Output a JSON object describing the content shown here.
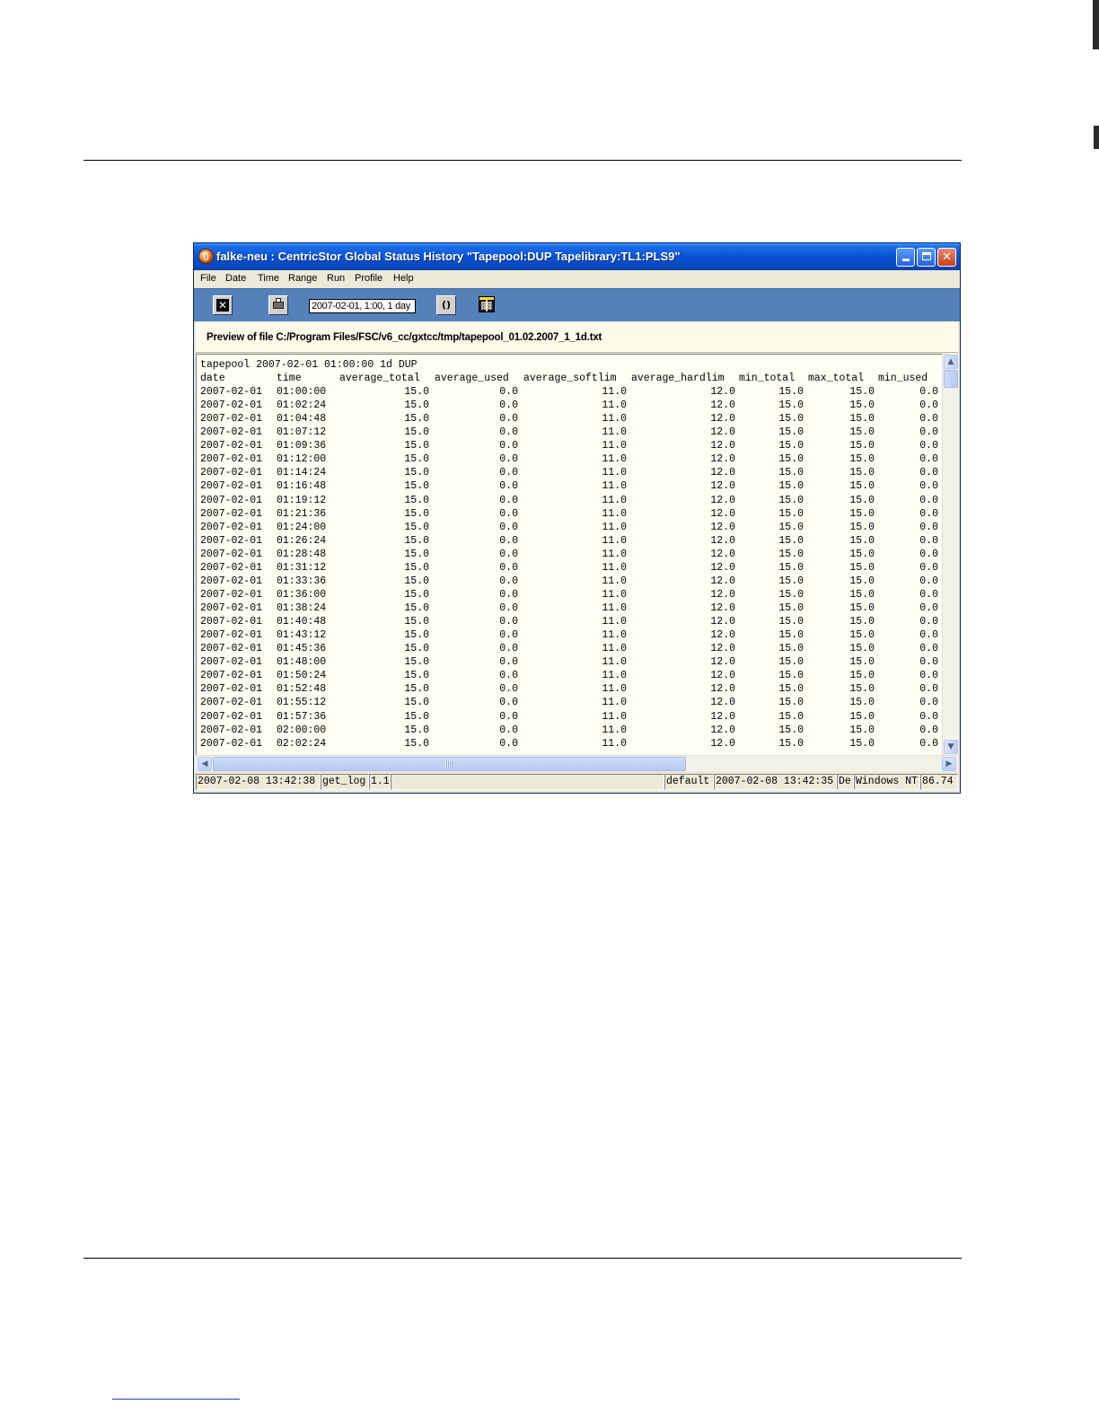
{
  "window": {
    "title": "falke-neu : CentricStor Global Status History \"Tapepool:DUP Tapelibrary:TL1:PLS9\""
  },
  "menu": {
    "items": [
      {
        "label": "File"
      },
      {
        "label": "Date"
      },
      {
        "label": "Time"
      },
      {
        "label": "Range"
      },
      {
        "label": "Run"
      },
      {
        "label": "Profile"
      },
      {
        "label": "Help"
      }
    ]
  },
  "toolbar": {
    "range_value": "2007-02-01, 1:00, 1 day",
    "icons": [
      "exit-icon",
      "print-icon",
      "refresh-icon",
      "calendar-icon"
    ]
  },
  "preview": {
    "label": "Preview of file C:/Program Files/FSC/v6_cc/gxtcc/tmp/tapepool_01.02.2007_1_1d.txt"
  },
  "file": {
    "title_line": "tapepool 2007-02-01 01:00:00 1d DUP",
    "columns": [
      "date",
      "time",
      "average_total",
      "average_used",
      "average_softlim",
      "average_hardlim",
      "min_total",
      "max_total",
      "min_used"
    ],
    "rows": [
      [
        "2007-02-01",
        "01:00:00",
        "15.0",
        "0.0",
        "11.0",
        "12.0",
        "15.0",
        "15.0",
        "0.0"
      ],
      [
        "2007-02-01",
        "01:02:24",
        "15.0",
        "0.0",
        "11.0",
        "12.0",
        "15.0",
        "15.0",
        "0.0"
      ],
      [
        "2007-02-01",
        "01:04:48",
        "15.0",
        "0.0",
        "11.0",
        "12.0",
        "15.0",
        "15.0",
        "0.0"
      ],
      [
        "2007-02-01",
        "01:07:12",
        "15.0",
        "0.0",
        "11.0",
        "12.0",
        "15.0",
        "15.0",
        "0.0"
      ],
      [
        "2007-02-01",
        "01:09:36",
        "15.0",
        "0.0",
        "11.0",
        "12.0",
        "15.0",
        "15.0",
        "0.0"
      ],
      [
        "2007-02-01",
        "01:12:00",
        "15.0",
        "0.0",
        "11.0",
        "12.0",
        "15.0",
        "15.0",
        "0.0"
      ],
      [
        "2007-02-01",
        "01:14:24",
        "15.0",
        "0.0",
        "11.0",
        "12.0",
        "15.0",
        "15.0",
        "0.0"
      ],
      [
        "2007-02-01",
        "01:16:48",
        "15.0",
        "0.0",
        "11.0",
        "12.0",
        "15.0",
        "15.0",
        "0.0"
      ],
      [
        "2007-02-01",
        "01:19:12",
        "15.0",
        "0.0",
        "11.0",
        "12.0",
        "15.0",
        "15.0",
        "0.0"
      ],
      [
        "2007-02-01",
        "01:21:36",
        "15.0",
        "0.0",
        "11.0",
        "12.0",
        "15.0",
        "15.0",
        "0.0"
      ],
      [
        "2007-02-01",
        "01:24:00",
        "15.0",
        "0.0",
        "11.0",
        "12.0",
        "15.0",
        "15.0",
        "0.0"
      ],
      [
        "2007-02-01",
        "01:26:24",
        "15.0",
        "0.0",
        "11.0",
        "12.0",
        "15.0",
        "15.0",
        "0.0"
      ],
      [
        "2007-02-01",
        "01:28:48",
        "15.0",
        "0.0",
        "11.0",
        "12.0",
        "15.0",
        "15.0",
        "0.0"
      ],
      [
        "2007-02-01",
        "01:31:12",
        "15.0",
        "0.0",
        "11.0",
        "12.0",
        "15.0",
        "15.0",
        "0.0"
      ],
      [
        "2007-02-01",
        "01:33:36",
        "15.0",
        "0.0",
        "11.0",
        "12.0",
        "15.0",
        "15.0",
        "0.0"
      ],
      [
        "2007-02-01",
        "01:36:00",
        "15.0",
        "0.0",
        "11.0",
        "12.0",
        "15.0",
        "15.0",
        "0.0"
      ],
      [
        "2007-02-01",
        "01:38:24",
        "15.0",
        "0.0",
        "11.0",
        "12.0",
        "15.0",
        "15.0",
        "0.0"
      ],
      [
        "2007-02-01",
        "01:40:48",
        "15.0",
        "0.0",
        "11.0",
        "12.0",
        "15.0",
        "15.0",
        "0.0"
      ],
      [
        "2007-02-01",
        "01:43:12",
        "15.0",
        "0.0",
        "11.0",
        "12.0",
        "15.0",
        "15.0",
        "0.0"
      ],
      [
        "2007-02-01",
        "01:45:36",
        "15.0",
        "0.0",
        "11.0",
        "12.0",
        "15.0",
        "15.0",
        "0.0"
      ],
      [
        "2007-02-01",
        "01:48:00",
        "15.0",
        "0.0",
        "11.0",
        "12.0",
        "15.0",
        "15.0",
        "0.0"
      ],
      [
        "2007-02-01",
        "01:50:24",
        "15.0",
        "0.0",
        "11.0",
        "12.0",
        "15.0",
        "15.0",
        "0.0"
      ],
      [
        "2007-02-01",
        "01:52:48",
        "15.0",
        "0.0",
        "11.0",
        "12.0",
        "15.0",
        "15.0",
        "0.0"
      ],
      [
        "2007-02-01",
        "01:55:12",
        "15.0",
        "0.0",
        "11.0",
        "12.0",
        "15.0",
        "15.0",
        "0.0"
      ],
      [
        "2007-02-01",
        "01:57:36",
        "15.0",
        "0.0",
        "11.0",
        "12.0",
        "15.0",
        "15.0",
        "0.0"
      ],
      [
        "2007-02-01",
        "02:00:00",
        "15.0",
        "0.0",
        "11.0",
        "12.0",
        "15.0",
        "15.0",
        "0.0"
      ],
      [
        "2007-02-01",
        "02:02:24",
        "15.0",
        "0.0",
        "11.0",
        "12.0",
        "15.0",
        "15.0",
        "0.0"
      ]
    ]
  },
  "statusbar": {
    "timestamp": "2007-02-08 13:42:38",
    "command": "get_log",
    "version": "1.1",
    "empty": "",
    "profile": "default",
    "timestamp2": "2007-02-08 13:42:35",
    "lang": "De",
    "os": "Windows NT",
    "value": "86.74"
  },
  "colors": {
    "titlebar": "#0a52d4",
    "toolbar": "#5581bb",
    "text_area_bg": "#fffff4",
    "preview_bg": "#fffbea"
  }
}
